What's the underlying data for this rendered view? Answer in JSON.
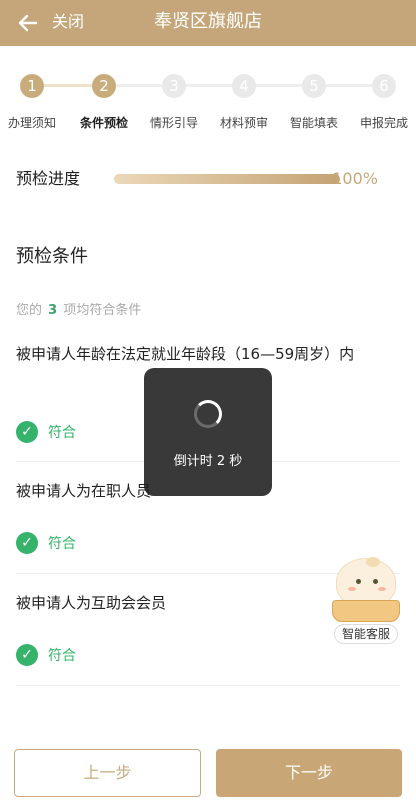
{
  "header": {
    "close_label": "关闭",
    "title": "奉贤区旗舰店",
    "background": "#c4a67a"
  },
  "steps": [
    {
      "number": "1",
      "label": "办理须知",
      "state": "done"
    },
    {
      "number": "2",
      "label": "条件预检",
      "state": "current"
    },
    {
      "number": "3",
      "label": "情形引导",
      "state": "pending"
    },
    {
      "number": "4",
      "label": "材料预审",
      "state": "pending"
    },
    {
      "number": "5",
      "label": "智能填表",
      "state": "pending"
    },
    {
      "number": "6",
      "label": "申报完成",
      "state": "pending"
    }
  ],
  "progress": {
    "label": "预检进度",
    "value_text": "100%",
    "fraction": 1.0
  },
  "precheck": {
    "title": "预检条件",
    "summary_prefix": "您的",
    "summary_count": "3",
    "summary_suffix": "项均符合条件"
  },
  "conditions": [
    {
      "text": "被申请人年龄在法定就业年龄段（16—59周岁）内",
      "status": "符合"
    },
    {
      "text": "被申请人为在职人员",
      "status": "符合"
    },
    {
      "text": "被申请人为互助会会员",
      "status": "符合"
    }
  ],
  "toast": {
    "text": "倒计时 2 秒"
  },
  "assistant": {
    "label": "智能客服"
  },
  "buttons": {
    "prev": "上一步",
    "next": "下一步"
  },
  "colors": {
    "accent": "#c8a676",
    "success": "#35b36b"
  }
}
